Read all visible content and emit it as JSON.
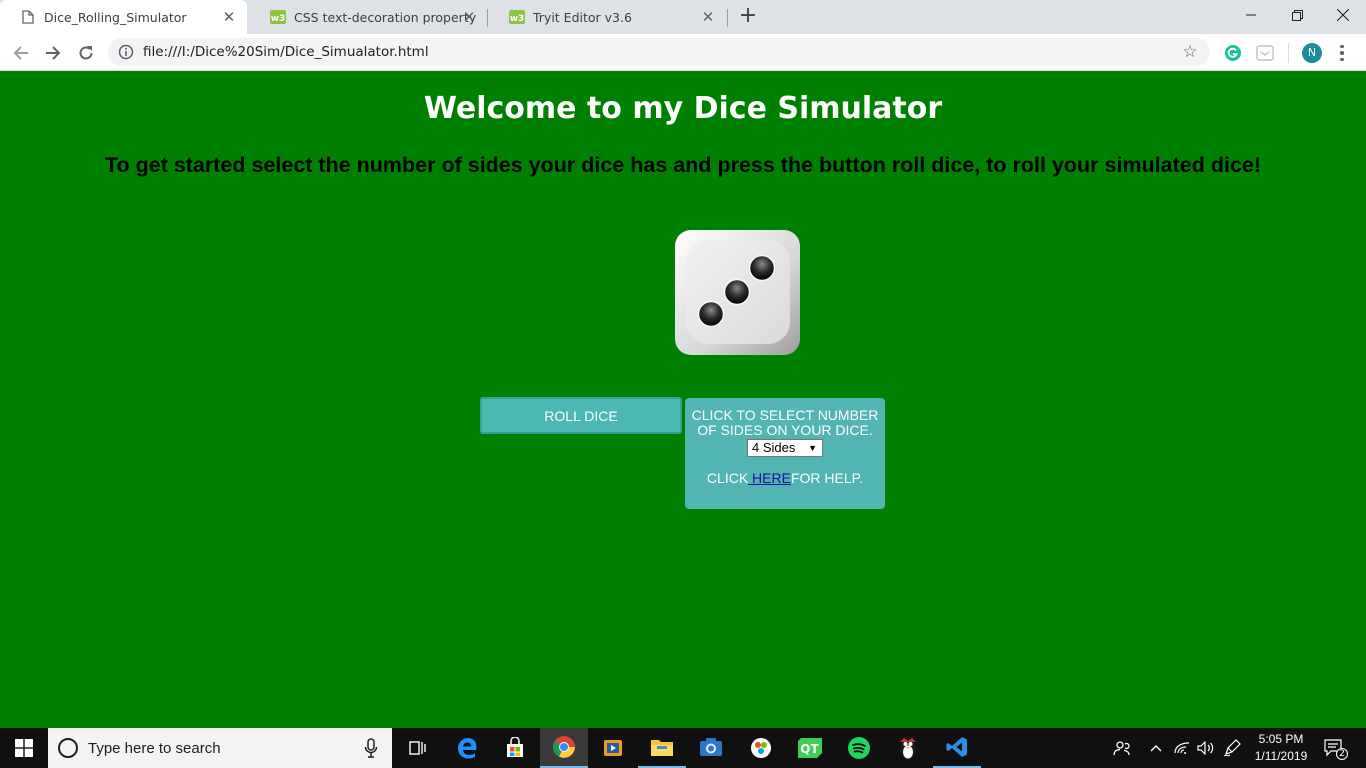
{
  "browser": {
    "tabs": [
      {
        "title": "Dice_Rolling_Simulator",
        "active": true,
        "favicon": "document-icon"
      },
      {
        "title": "CSS text-decoration property",
        "active": false,
        "favicon": "w3schools-icon"
      },
      {
        "title": "Tryit Editor v3.6",
        "active": false,
        "favicon": "w3schools-icon"
      }
    ],
    "url": "file:///I:/Dice%20Sim/Dice_Simualator.html",
    "profile_initial": "N"
  },
  "page": {
    "title": "Welcome to my Dice Simulator",
    "subtitle": "To get started select the number of sides your dice has and press the button roll dice, to roll your simulated dice!",
    "dice_face_value": 3,
    "roll_button_label": "ROLL DICE",
    "sides_panel": {
      "instruction": "CLICK TO SELECT NUMBER OF SIDES ON YOUR DICE.",
      "selected_option": "4 Sides",
      "help_prefix": "CLICK",
      "help_link": " HERE",
      "help_suffix": "FOR HELP."
    }
  },
  "taskbar": {
    "search_placeholder": "Type here to search",
    "time": "5:05 PM",
    "date": "1/11/2019",
    "notification_count": "2"
  },
  "colors": {
    "page_background": "#008000",
    "button_teal": "#52b5b1",
    "title_text": "#ffffff",
    "subtitle_text": "#000000"
  }
}
